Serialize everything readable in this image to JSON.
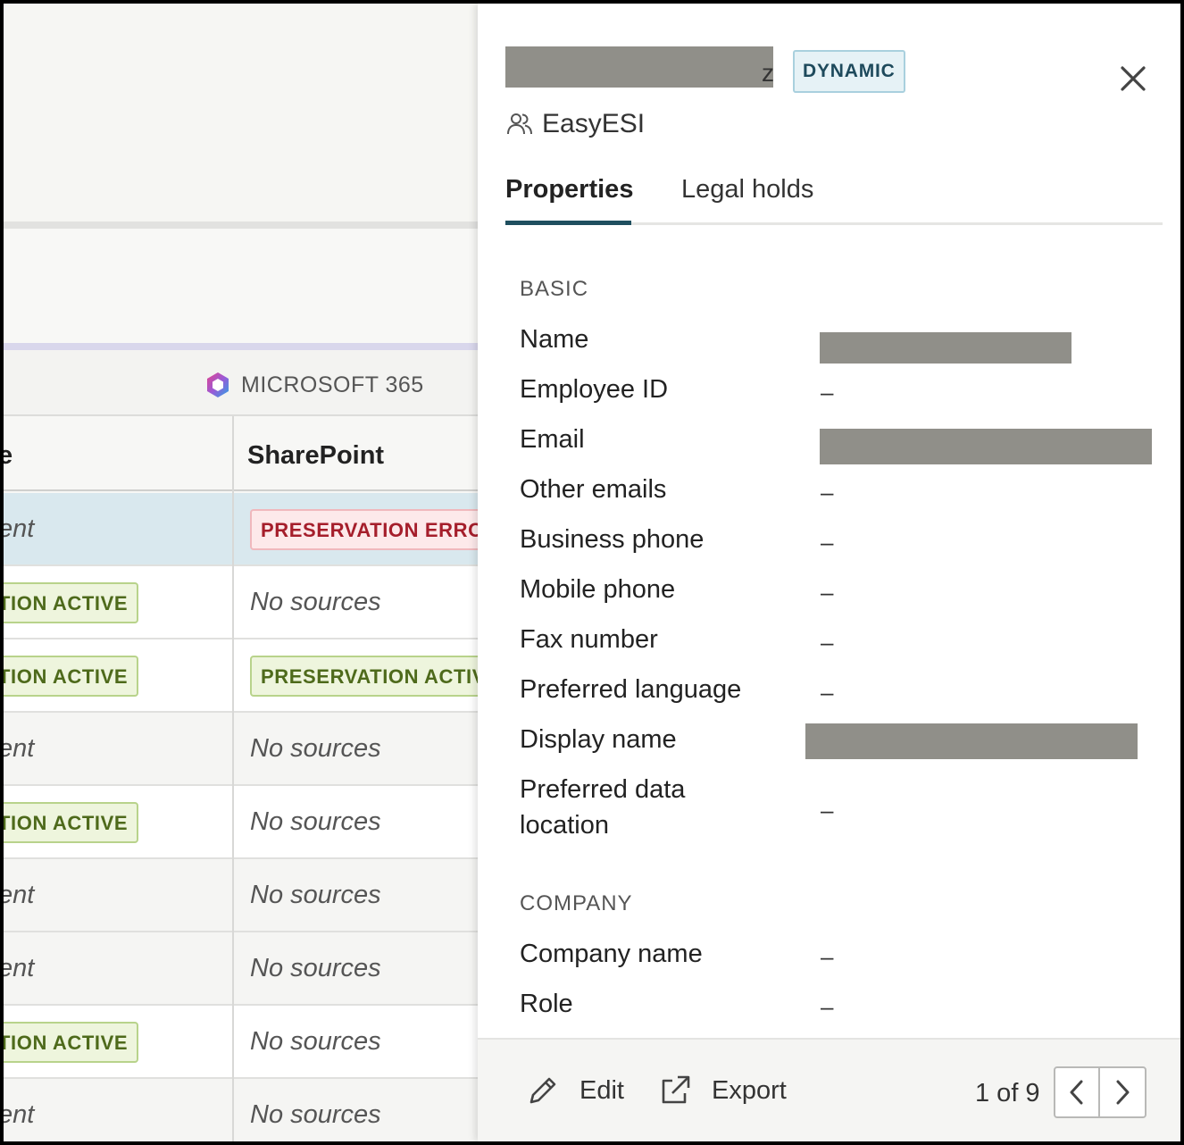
{
  "background": {
    "source_group": "MICROSOFT 365",
    "columns": {
      "left_partial": "e",
      "right": "SharePoint"
    },
    "rows": [
      {
        "left": {
          "kind": "text",
          "text": "ent"
        },
        "right": {
          "kind": "badge-red",
          "text": "PRESERVATION ERROR"
        },
        "tone": "blue"
      },
      {
        "left": {
          "kind": "badge-green",
          "text": "TION ACTIVE"
        },
        "right": {
          "kind": "text",
          "text": "No sources"
        },
        "tone": "white"
      },
      {
        "left": {
          "kind": "badge-green",
          "text": "TION ACTIVE"
        },
        "right": {
          "kind": "badge-green",
          "text": "PRESERVATION ACTIVE"
        },
        "tone": "white"
      },
      {
        "left": {
          "kind": "text",
          "text": "ent"
        },
        "right": {
          "kind": "text",
          "text": "No sources"
        },
        "tone": "grey"
      },
      {
        "left": {
          "kind": "badge-green",
          "text": "TION ACTIVE"
        },
        "right": {
          "kind": "text",
          "text": "No sources"
        },
        "tone": "white"
      },
      {
        "left": {
          "kind": "text",
          "text": "ent"
        },
        "right": {
          "kind": "text",
          "text": "No sources"
        },
        "tone": "grey"
      },
      {
        "left": {
          "kind": "text",
          "text": "ent"
        },
        "right": {
          "kind": "text",
          "text": "No sources"
        },
        "tone": "grey"
      },
      {
        "left": {
          "kind": "badge-green",
          "text": "TION ACTIVE"
        },
        "right": {
          "kind": "text",
          "text": "No sources"
        },
        "tone": "white"
      },
      {
        "left": {
          "kind": "text",
          "text": "ent"
        },
        "right": {
          "kind": "text",
          "text": "No sources"
        },
        "tone": "grey"
      }
    ]
  },
  "panel": {
    "title_tail": "z",
    "badge": "DYNAMIC",
    "organization": "EasyESI",
    "tabs": {
      "properties": "Properties",
      "legal_holds": "Legal holds"
    },
    "sections": {
      "basic": {
        "title": "BASIC",
        "name_label": "Name",
        "employee_id_label": "Employee ID",
        "employee_id_value": "–",
        "email_label": "Email",
        "other_emails_label": "Other emails",
        "other_emails_value": "–",
        "business_phone_label": "Business phone",
        "business_phone_value": "–",
        "mobile_phone_label": "Mobile phone",
        "mobile_phone_value": "–",
        "fax_number_label": "Fax number",
        "fax_number_value": "–",
        "preferred_language_label": "Preferred language",
        "preferred_language_value": "–",
        "display_name_label": "Display name",
        "preferred_data_location_label_1": "Preferred data",
        "preferred_data_location_label_2": "location",
        "preferred_data_location_value": "–"
      },
      "company": {
        "title": "COMPANY",
        "company_name_label": "Company name",
        "company_name_value": "–",
        "role_label": "Role",
        "role_value": "–"
      }
    },
    "footer": {
      "edit_label": "Edit",
      "export_label": "Export",
      "pager": "1 of 9"
    }
  },
  "colors": {
    "accent": "#1f4f5f",
    "badge_green_bg": "#eef5dd",
    "badge_red_bg": "#fde9ea",
    "dynamic_badge_bg": "#e6f2f6",
    "redaction": "#908f89"
  }
}
